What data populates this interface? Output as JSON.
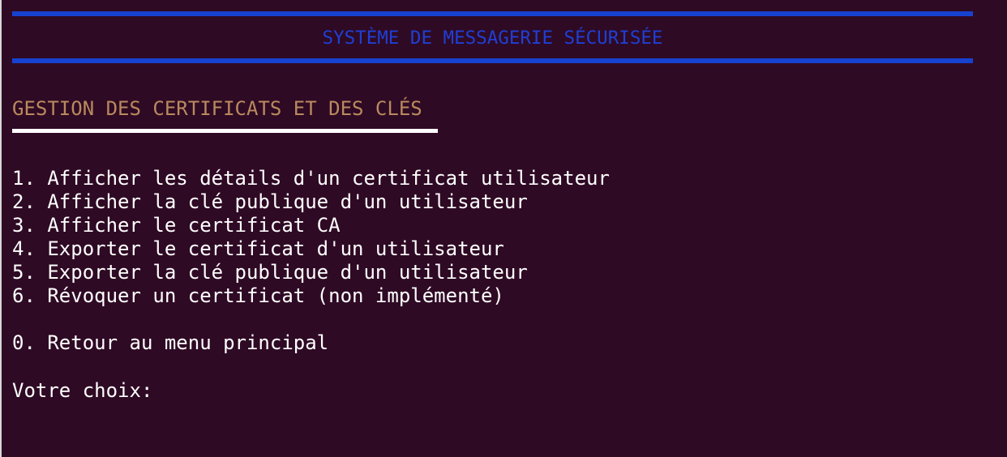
{
  "header": {
    "title": "SYSTÈME DE MESSAGERIE SÉCURISÉE"
  },
  "section": {
    "heading": "GESTION DES CERTIFICATS ET DES CLÉS"
  },
  "menu": {
    "items": [
      {
        "label": "1. Afficher les détails d'un certificat utilisateur"
      },
      {
        "label": "2. Afficher la clé publique d'un utilisateur"
      },
      {
        "label": "3. Afficher le certificat CA"
      },
      {
        "label": "4. Exporter le certificat d'un utilisateur"
      },
      {
        "label": "5. Exporter la clé publique d'un utilisateur"
      },
      {
        "label": "6. Révoquer un certificat (non implémenté)"
      }
    ],
    "return_label": "0. Retour au menu principal"
  },
  "prompt": {
    "label": "Votre choix:",
    "value": ""
  },
  "colors": {
    "background": "#2f0a24",
    "banner": "#1742d0",
    "banner_text": "#1f3fd6",
    "heading_text": "#b98a5e",
    "text": "#ffffff"
  }
}
